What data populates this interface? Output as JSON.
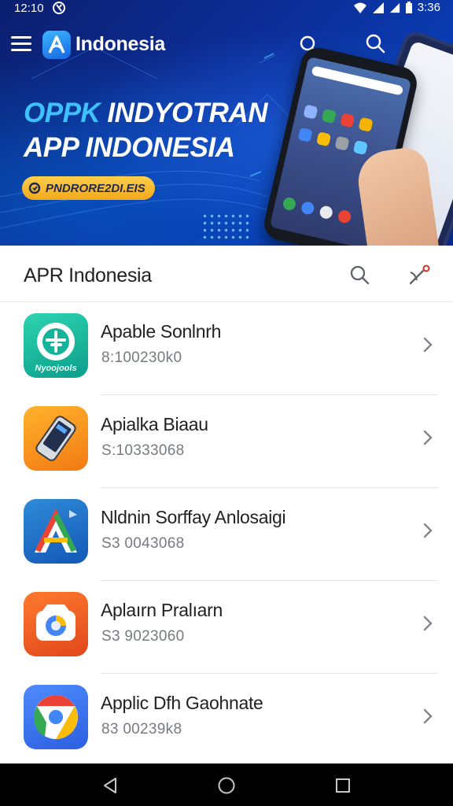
{
  "status_bar": {
    "time": "12:10",
    "right_time": "3:36"
  },
  "app_bar": {
    "title": "Indonesia"
  },
  "hero": {
    "headline_accent": "OPPK",
    "headline_rest": " INDYOTRAN",
    "headline_line2": "APP INDONESIA",
    "pill_label": "PNDRORE2DI.EIS"
  },
  "section": {
    "title": "APR Indonesia"
  },
  "apps": [
    {
      "name": "Apable Sonlnrh",
      "sub": "8:100230k0",
      "icon": "green-shield-app-icon",
      "icon_caption": "Nyoojools"
    },
    {
      "name": "Apialka Biaau",
      "sub": "S:10333068",
      "icon": "orange-phone-app-icon"
    },
    {
      "name": "Nldnin Sorffay Anlosaigi",
      "sub": "S3 0043068",
      "icon": "blue-a-app-icon"
    },
    {
      "name": "Aplaırn Pralıarn",
      "sub": "S3 9023060",
      "icon": "orange-camera-app-icon"
    },
    {
      "name": "Applic Dfh Gaohnate",
      "sub": "83 00239k8",
      "icon": "chrome-app-icon"
    }
  ],
  "colors": {
    "hero_dark": "#0b1f6e",
    "hero_accent": "#3fc1ff",
    "pill": "#f2b72a",
    "text": "#202124",
    "subtext": "#777a80"
  }
}
